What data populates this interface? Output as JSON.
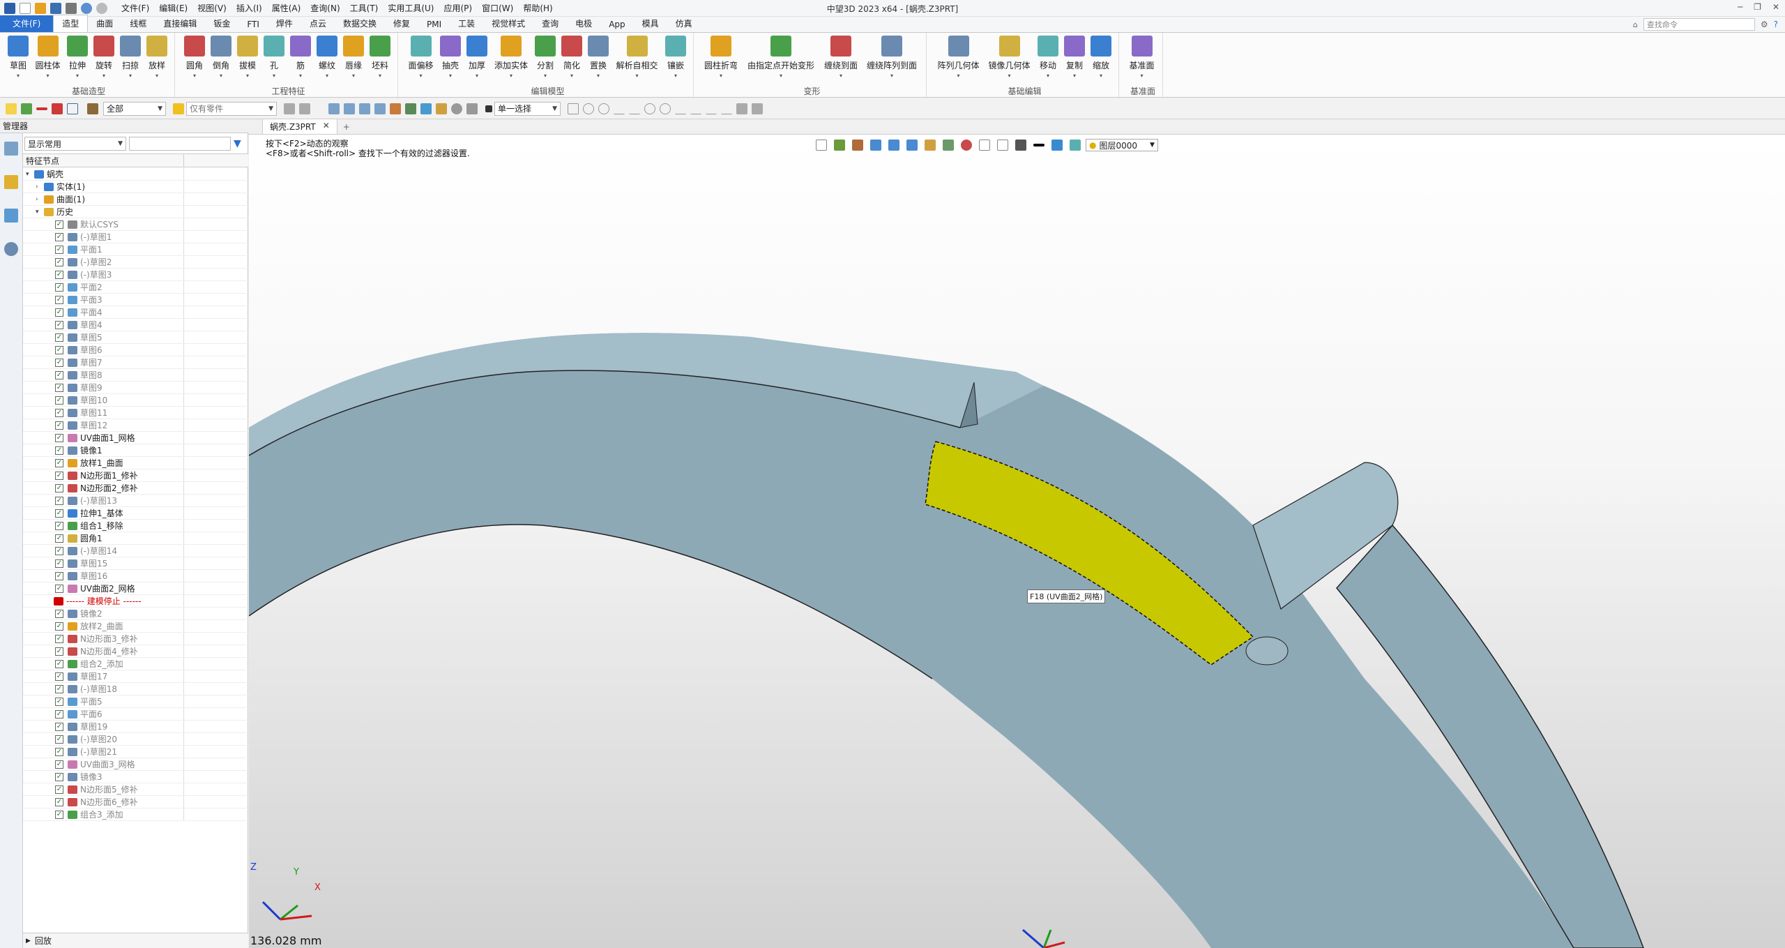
{
  "window": {
    "title": "中望3D 2023 x64 - [蜗壳.Z3PRT]",
    "menus": [
      "文件(F)",
      "编辑(E)",
      "视图(V)",
      "插入(I)",
      "属性(A)",
      "查询(N)",
      "工具(T)",
      "实用工具(U)",
      "应用(P)",
      "窗口(W)",
      "帮助(H)"
    ]
  },
  "ribbon_tabs": [
    "文件(F)",
    "造型",
    "曲面",
    "线框",
    "直接编辑",
    "钣金",
    "FTI",
    "焊件",
    "点云",
    "数据交换",
    "修复",
    "PMI",
    "工装",
    "视觉样式",
    "查询",
    "电极",
    "App",
    "模具",
    "仿真"
  ],
  "active_tab": "造型",
  "search_placeholder": "查找命令",
  "ribbon_groups": [
    {
      "label": "基础造型",
      "buttons": [
        "草图",
        "圆柱体",
        "拉伸",
        "旋转",
        "扫掠",
        "放样"
      ]
    },
    {
      "label": "工程特征",
      "buttons": [
        "圆角",
        "倒角",
        "拔模",
        "孔",
        "筋",
        "螺纹",
        "唇缘",
        "坯料"
      ]
    },
    {
      "label": "编辑模型",
      "buttons": [
        "面偏移",
        "抽壳",
        "加厚",
        "添加实体",
        "分割",
        "简化",
        "置换",
        "解析自相交",
        "镶嵌"
      ]
    },
    {
      "label": "变形",
      "buttons": [
        "圆柱折弯",
        "由指定点开始变形",
        "缠绕到面",
        "缠绕阵列到面"
      ]
    },
    {
      "label": "基础编辑",
      "buttons": [
        "阵列几何体",
        "镜像几何体",
        "移动",
        "复制",
        "缩放"
      ]
    },
    {
      "label": "基准面",
      "buttons": [
        "基准面"
      ]
    }
  ],
  "toolbar2": {
    "filter_value": "全部",
    "part_filter": "仅有零件",
    "select_mode": "单一选择"
  },
  "manager": {
    "title": "管理器",
    "display_filter": "显示常用",
    "tree_header": "特征节点",
    "bottom_label": "回放"
  },
  "tree": [
    {
      "label": "蜗壳",
      "indent": 0,
      "icon": "part-icon",
      "check": false,
      "expand": "v"
    },
    {
      "label": "实体(1)",
      "indent": 1,
      "icon": "solid-icon",
      "check": false,
      "expand": ">"
    },
    {
      "label": "曲面(1)",
      "indent": 1,
      "icon": "surface-icon",
      "check": false,
      "expand": ">"
    },
    {
      "label": "历史",
      "indent": 1,
      "icon": "folder-icon",
      "check": false,
      "expand": "v"
    },
    {
      "label": "默认CSYS",
      "indent": 2,
      "icon": "csys-icon",
      "check": true,
      "state": "grey"
    },
    {
      "label": "(-)草图1",
      "indent": 2,
      "icon": "sketch-icon",
      "check": true,
      "state": "grey"
    },
    {
      "label": "平面1",
      "indent": 2,
      "icon": "plane-icon",
      "check": true,
      "state": "grey"
    },
    {
      "label": "(-)草图2",
      "indent": 2,
      "icon": "sketch-icon",
      "check": true,
      "state": "grey"
    },
    {
      "label": "(-)草图3",
      "indent": 2,
      "icon": "sketch-icon",
      "check": true,
      "state": "grey"
    },
    {
      "label": "平面2",
      "indent": 2,
      "icon": "plane-icon",
      "check": true,
      "state": "grey"
    },
    {
      "label": "平面3",
      "indent": 2,
      "icon": "plane-icon",
      "check": true,
      "state": "grey"
    },
    {
      "label": "平面4",
      "indent": 2,
      "icon": "plane-icon",
      "check": true,
      "state": "grey"
    },
    {
      "label": "草图4",
      "indent": 2,
      "icon": "sketch-icon",
      "check": true,
      "state": "grey"
    },
    {
      "label": "草图5",
      "indent": 2,
      "icon": "sketch-icon",
      "check": true,
      "state": "grey"
    },
    {
      "label": "草图6",
      "indent": 2,
      "icon": "sketch-icon",
      "check": true,
      "state": "grey"
    },
    {
      "label": "草图7",
      "indent": 2,
      "icon": "sketch-icon",
      "check": true,
      "state": "grey"
    },
    {
      "label": "草图8",
      "indent": 2,
      "icon": "sketch-icon",
      "check": true,
      "state": "grey"
    },
    {
      "label": "草图9",
      "indent": 2,
      "icon": "sketch-icon",
      "check": true,
      "state": "grey"
    },
    {
      "label": "草图10",
      "indent": 2,
      "icon": "sketch-icon",
      "check": true,
      "state": "grey"
    },
    {
      "label": "草图11",
      "indent": 2,
      "icon": "sketch-icon",
      "check": true,
      "state": "grey"
    },
    {
      "label": "草图12",
      "indent": 2,
      "icon": "sketch-icon",
      "check": true,
      "state": "grey"
    },
    {
      "label": "UV曲面1_网格",
      "indent": 2,
      "icon": "uv-surface-icon",
      "check": true,
      "state": "normal"
    },
    {
      "label": "镜像1",
      "indent": 2,
      "icon": "mirror-icon",
      "check": true,
      "state": "normal"
    },
    {
      "label": "放样1_曲面",
      "indent": 2,
      "icon": "loft-icon",
      "check": true,
      "state": "normal"
    },
    {
      "label": "N边形面1_修补",
      "indent": 2,
      "icon": "nside-icon",
      "check": true,
      "state": "normal"
    },
    {
      "label": "N边形面2_修补",
      "indent": 2,
      "icon": "nside-icon",
      "check": true,
      "state": "normal"
    },
    {
      "label": "(-)草图13",
      "indent": 2,
      "icon": "sketch-icon",
      "check": true,
      "state": "grey"
    },
    {
      "label": "拉伸1_基体",
      "indent": 2,
      "icon": "extrude-icon",
      "check": true,
      "state": "normal"
    },
    {
      "label": "组合1_移除",
      "indent": 2,
      "icon": "combine-icon",
      "check": true,
      "state": "normal"
    },
    {
      "label": "圆角1",
      "indent": 2,
      "icon": "fillet-icon",
      "check": true,
      "state": "normal"
    },
    {
      "label": "(-)草图14",
      "indent": 2,
      "icon": "sketch-icon",
      "check": true,
      "state": "grey"
    },
    {
      "label": "草图15",
      "indent": 2,
      "icon": "sketch-icon",
      "check": true,
      "state": "grey"
    },
    {
      "label": "草图16",
      "indent": 2,
      "icon": "sketch-icon",
      "check": true,
      "state": "grey"
    },
    {
      "label": "UV曲面2_网格",
      "indent": 2,
      "icon": "uv-surface-icon",
      "check": true,
      "state": "normal"
    },
    {
      "label": "------ 建模停止 ------",
      "indent": 2,
      "icon": "stop-arrow-icon",
      "check": false,
      "state": "red"
    },
    {
      "label": "镜像2",
      "indent": 2,
      "icon": "mirror-icon",
      "check": true,
      "state": "grey"
    },
    {
      "label": "放样2_曲面",
      "indent": 2,
      "icon": "loft-icon",
      "check": true,
      "state": "grey"
    },
    {
      "label": "N边形面3_修补",
      "indent": 2,
      "icon": "nside-icon",
      "check": true,
      "state": "grey"
    },
    {
      "label": "N边形面4_修补",
      "indent": 2,
      "icon": "nside-icon",
      "check": true,
      "state": "grey"
    },
    {
      "label": "组合2_添加",
      "indent": 2,
      "icon": "combine-icon",
      "check": true,
      "state": "grey"
    },
    {
      "label": "草图17",
      "indent": 2,
      "icon": "sketch-icon",
      "check": true,
      "state": "grey"
    },
    {
      "label": "(-)草图18",
      "indent": 2,
      "icon": "sketch-icon",
      "check": true,
      "state": "grey"
    },
    {
      "label": "平面5",
      "indent": 2,
      "icon": "plane-icon",
      "check": true,
      "state": "grey"
    },
    {
      "label": "平面6",
      "indent": 2,
      "icon": "plane-icon",
      "check": true,
      "state": "grey"
    },
    {
      "label": "草图19",
      "indent": 2,
      "icon": "sketch-icon",
      "check": true,
      "state": "grey"
    },
    {
      "label": "(-)草图20",
      "indent": 2,
      "icon": "sketch-icon",
      "check": true,
      "state": "grey"
    },
    {
      "label": "(-)草图21",
      "indent": 2,
      "icon": "sketch-icon",
      "check": true,
      "state": "grey"
    },
    {
      "label": "UV曲面3_网格",
      "indent": 2,
      "icon": "uv-surface-icon",
      "check": true,
      "state": "grey"
    },
    {
      "label": "镜像3",
      "indent": 2,
      "icon": "mirror-icon",
      "check": true,
      "state": "grey"
    },
    {
      "label": "N边形面5_修补",
      "indent": 2,
      "icon": "nside-icon",
      "check": true,
      "state": "grey"
    },
    {
      "label": "N边形面6_修补",
      "indent": 2,
      "icon": "nside-icon",
      "check": true,
      "state": "grey"
    },
    {
      "label": "组合3_添加",
      "indent": 2,
      "icon": "combine-icon",
      "check": true,
      "state": "grey"
    }
  ],
  "document": {
    "tab": "蜗壳.Z3PRT"
  },
  "viewport": {
    "prompt_line1": "按下<F2>动态的观察",
    "prompt_line2": "<F8>或者<Shift-roll> 查找下一个有效的过滤器设置.",
    "layer": "图层0000",
    "tooltip": "F18 (UV曲面2_网格)",
    "measure": "136.028 mm",
    "axis_x": "X",
    "axis_y": "Y",
    "axis_z": "Z"
  },
  "colors": {
    "accent": "#2b6fcf",
    "model": "#8ea9b6",
    "highlight": "#c8c800",
    "stop": "#d00000"
  }
}
